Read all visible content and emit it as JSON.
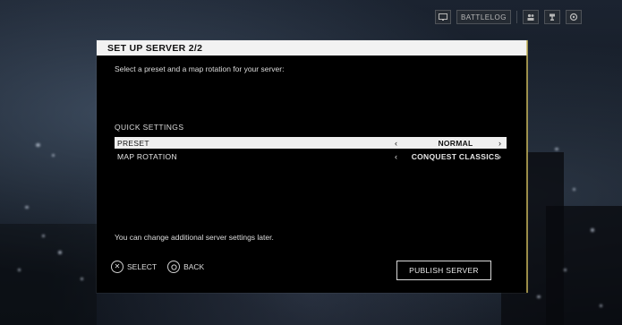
{
  "topbar": {
    "battlelog_label": "BATTLELOG",
    "icons": [
      "screen-icon",
      "friends-icon",
      "trophy-icon",
      "settings-icon"
    ]
  },
  "dialog": {
    "title": "SET UP SERVER 2/2",
    "intro": "Select a preset and a map rotation for your server:",
    "section_title": "QUICK SETTINGS",
    "rows": [
      {
        "label": "PRESET",
        "value": "NORMAL",
        "selected": true
      },
      {
        "label": "MAP ROTATION",
        "value": "CONQUEST CLASSICS",
        "selected": false
      }
    ],
    "note": "You can change additional server settings later.",
    "hints": {
      "select_label": "SELECT",
      "back_label": "BACK"
    },
    "publish_label": "PUBLISH SERVER"
  },
  "colors": {
    "header_bg": "#f2f2f2",
    "dialog_bg": "#000000",
    "accent_edge": "#c8b55a"
  }
}
